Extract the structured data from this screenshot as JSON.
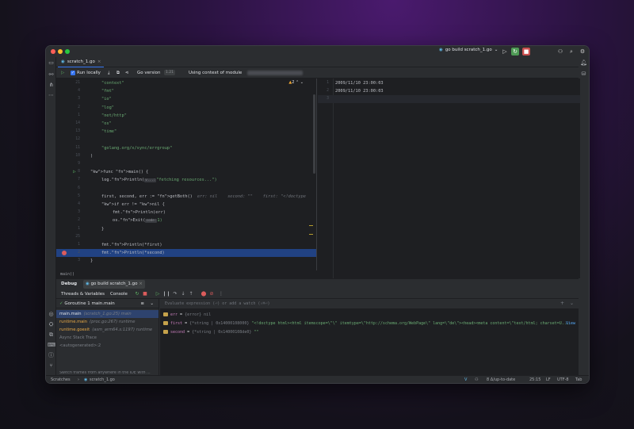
{
  "title_bar": {
    "run_config": "go build scratch_1.go"
  },
  "editor_tab": {
    "label": "scratch_1.go"
  },
  "toolbar": {
    "run_locally": "Run locally",
    "go_version_label": "Go version",
    "go_version_value": "1.21",
    "context_label": "Using context of module"
  },
  "editor": {
    "warnings": "2",
    "lines": [
      {
        "n": "21",
        "code": "\"context\""
      },
      {
        "n": "4",
        "code": "\"fmt\""
      },
      {
        "n": "3",
        "code": "\"io\""
      },
      {
        "n": "2",
        "code": "\"log\""
      },
      {
        "n": "1",
        "code": "\"net/http\""
      },
      {
        "n": "14",
        "code": "\"os\""
      },
      {
        "n": "13",
        "code": "\"time\""
      },
      {
        "n": "12",
        "code": ""
      },
      {
        "n": "11",
        "code": "\"golang.org/x/sync/errgroup\""
      },
      {
        "n": "10",
        "code": ")"
      },
      {
        "n": "9",
        "code": ""
      },
      {
        "n": "8",
        "code": "func main() {"
      },
      {
        "n": "7",
        "code": "log.Println(",
        "hint": "v...:",
        "tail": "\"fetching resources...\")"
      },
      {
        "n": "6",
        "code": ""
      },
      {
        "n": "5",
        "code": "first, second, err := getBoth()",
        "inline": "err: nil    second: \"\"    first: \"<!doctype"
      },
      {
        "n": "4",
        "code": "if err != nil {"
      },
      {
        "n": "3",
        "code": "fmt.Println(err)"
      },
      {
        "n": "2",
        "code": "os.Exit(",
        "hint": "code:",
        "tail": "1)"
      },
      {
        "n": "1",
        "code": "}"
      },
      {
        "n": "25",
        "code": ""
      },
      {
        "n": "1",
        "code": "fmt.Println(*first)"
      },
      {
        "n": "2",
        "code": "fmt.Println(*second)"
      },
      {
        "n": "3",
        "code": "}"
      }
    ],
    "breadcrumb": "main()"
  },
  "output": {
    "lines": [
      {
        "n": "1",
        "text": "2009/11/10 23:00:03"
      },
      {
        "n": "2",
        "text": "2009/11/10 23:00:03"
      },
      {
        "n": "3",
        "text": ""
      }
    ]
  },
  "debug": {
    "title": "Debug",
    "session_tab": "go build scratch_1.go",
    "tab_threads": "Threads & Variables",
    "tab_console": "Console",
    "goroutine": "Goroutine 1 main.main",
    "frames": [
      {
        "name": "main.main",
        "loc": "(scratch_1.go:25) main"
      },
      {
        "name": "runtime.main",
        "loc": "(proc.go:267) runtime"
      },
      {
        "name": "runtime.goexit",
        "loc": "(asm_arm64.s:1197) runtime"
      },
      {
        "name": "Async Stack Trace",
        "loc": ""
      },
      {
        "name": "<autogenerated>:2",
        "loc": ""
      }
    ],
    "tip": "Switch frames from anywhere in the IDE with ...",
    "eval_placeholder": "Evaluate expression (⏎) or add a watch (⇧⌘⏎)",
    "variables": [
      {
        "name": "err",
        "eq": " = ",
        "type": "{error} nil",
        "value": ""
      },
      {
        "name": "first",
        "eq": " = ",
        "type": "{*string | 0x14000108000}",
        "value": " \"<!doctype html><html itemscope=\\\"\\\" itemtype=\\\"http://schema.org/WebPage\\\" lang=\\\"de\\\"><head><meta content=\\\"text/html; charset=U...",
        "link": "View"
      },
      {
        "name": "second",
        "eq": " = ",
        "type": "{*string | 0x14000108de0}",
        "value": " \"\""
      }
    ]
  },
  "status_bar": {
    "crumb1": "Scratches",
    "crumb2": "scratch_1.go",
    "vcs": "8 Δ/up-to-date",
    "position": "25:15",
    "line_sep": "LF",
    "encoding": "UTF-8",
    "indent": "Tab"
  },
  "colors": {
    "accent": "#3574f0",
    "background": "#1e1f22",
    "panel": "#2b2d30",
    "string": "#6aab73",
    "keyword": "#cf8e6d",
    "function": "#56a8f5",
    "breakpoint": "#db5c5c"
  }
}
